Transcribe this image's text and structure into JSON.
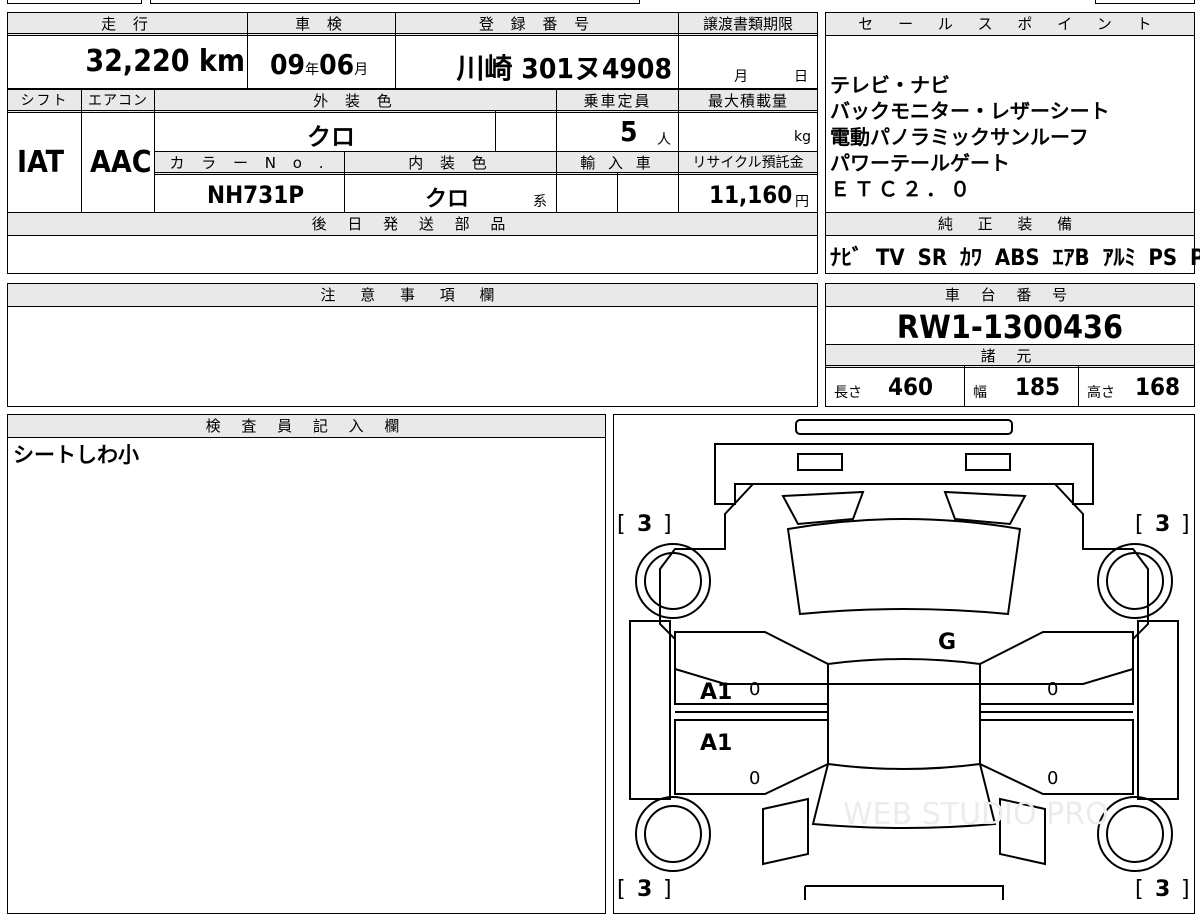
{
  "top": {
    "headers": {
      "mileage": "走 行",
      "inspection": "車 検",
      "registration": "登 録 番 号",
      "transfer_deadline": "譲渡書類期限",
      "sales_points": "セ ー ル ス ポ イ ン ト"
    },
    "mileage": "32,220",
    "mileage_unit": "km",
    "inspection_year": "09",
    "year_unit": "年",
    "inspection_month": "06",
    "month_unit": "月",
    "registration_number": "川崎 301ヌ4908",
    "deadline_month_unit": "月",
    "deadline_day_unit": "日"
  },
  "spec": {
    "headers": {
      "shift": "シフト",
      "aircon": "エアコン",
      "exterior_color": "外 装 色",
      "capacity": "乗車定員",
      "max_load": "最大積載量",
      "color_no": "カ ラ ー N o .",
      "interior_color": "内 装 色",
      "import": "輸 入 車",
      "recycle_fee": "リサイクル預託金"
    },
    "shift": "IAT",
    "aircon": "AAC",
    "exterior_color": "クロ",
    "capacity": "5",
    "capacity_unit": "人",
    "max_load_unit": "kg",
    "color_no": "NH731P",
    "interior_color": "クロ",
    "interior_suffix": "系",
    "recycle_fee": "11,160",
    "recycle_unit": "円"
  },
  "sales_points": [
    "テレビ・ナビ",
    "バックモニター・レザーシート",
    "電動パノラミックサンルーフ",
    "パワーテールゲート",
    "ＥＴＣ２．０"
  ],
  "later_parts": {
    "header": "後 日 発 送 部 品"
  },
  "equipment": {
    "header": "純 正 装 備",
    "items": [
      "ﾅﾋﾞ",
      "TV",
      "SR",
      "ｶﾜ",
      "ABS",
      "ｴｱB",
      "ｱﾙﾐ",
      "PS",
      "PW"
    ]
  },
  "notes": {
    "header": "注 意 事 項 欄"
  },
  "chassis": {
    "header": "車 台 番 号",
    "number": "RW1-1300436"
  },
  "dimensions": {
    "header": "諸 元",
    "length_label": "長さ",
    "length": "460",
    "width_label": "幅",
    "width": "185",
    "height_label": "高さ",
    "height": "168"
  },
  "inspector": {
    "header": "検 査 員 記 入 欄",
    "comment": "シートしわ小"
  },
  "diagram": {
    "tire_fl": "3",
    "tire_fr": "3",
    "tire_rl": "3",
    "tire_rr": "3",
    "mark_windshield": "G",
    "mark_left_front_door": "A1",
    "mark_left_rear_door": "A1",
    "mark_lf_zero": "0",
    "mark_lr_zero": "0",
    "mark_rf_zero": "0",
    "mark_rr_zero": "0",
    "watermark": "WEB STUDIO PRO"
  }
}
